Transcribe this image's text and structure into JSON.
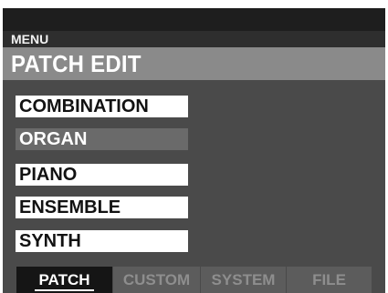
{
  "header": {
    "menu_label": "MENU",
    "title": "PATCH EDIT"
  },
  "menu": {
    "items": [
      {
        "label": "COMBINATION",
        "selected": false
      },
      {
        "label": "ORGAN",
        "selected": true
      },
      {
        "label": "PIANO",
        "selected": false
      },
      {
        "label": "ENSEMBLE",
        "selected": false
      },
      {
        "label": "SYNTH",
        "selected": false
      }
    ]
  },
  "tabs": [
    {
      "label": "PATCH",
      "active": true
    },
    {
      "label": "CUSTOM",
      "active": false
    },
    {
      "label": "SYSTEM",
      "active": false
    },
    {
      "label": "FILE",
      "active": false
    }
  ],
  "colors": {
    "screen_background": "#4a4a4a",
    "title_bar": "#8a8a8a",
    "selected_item": "#6a6a6a",
    "active_tab": "#151515",
    "inactive_tab": "#5c5c5c"
  }
}
